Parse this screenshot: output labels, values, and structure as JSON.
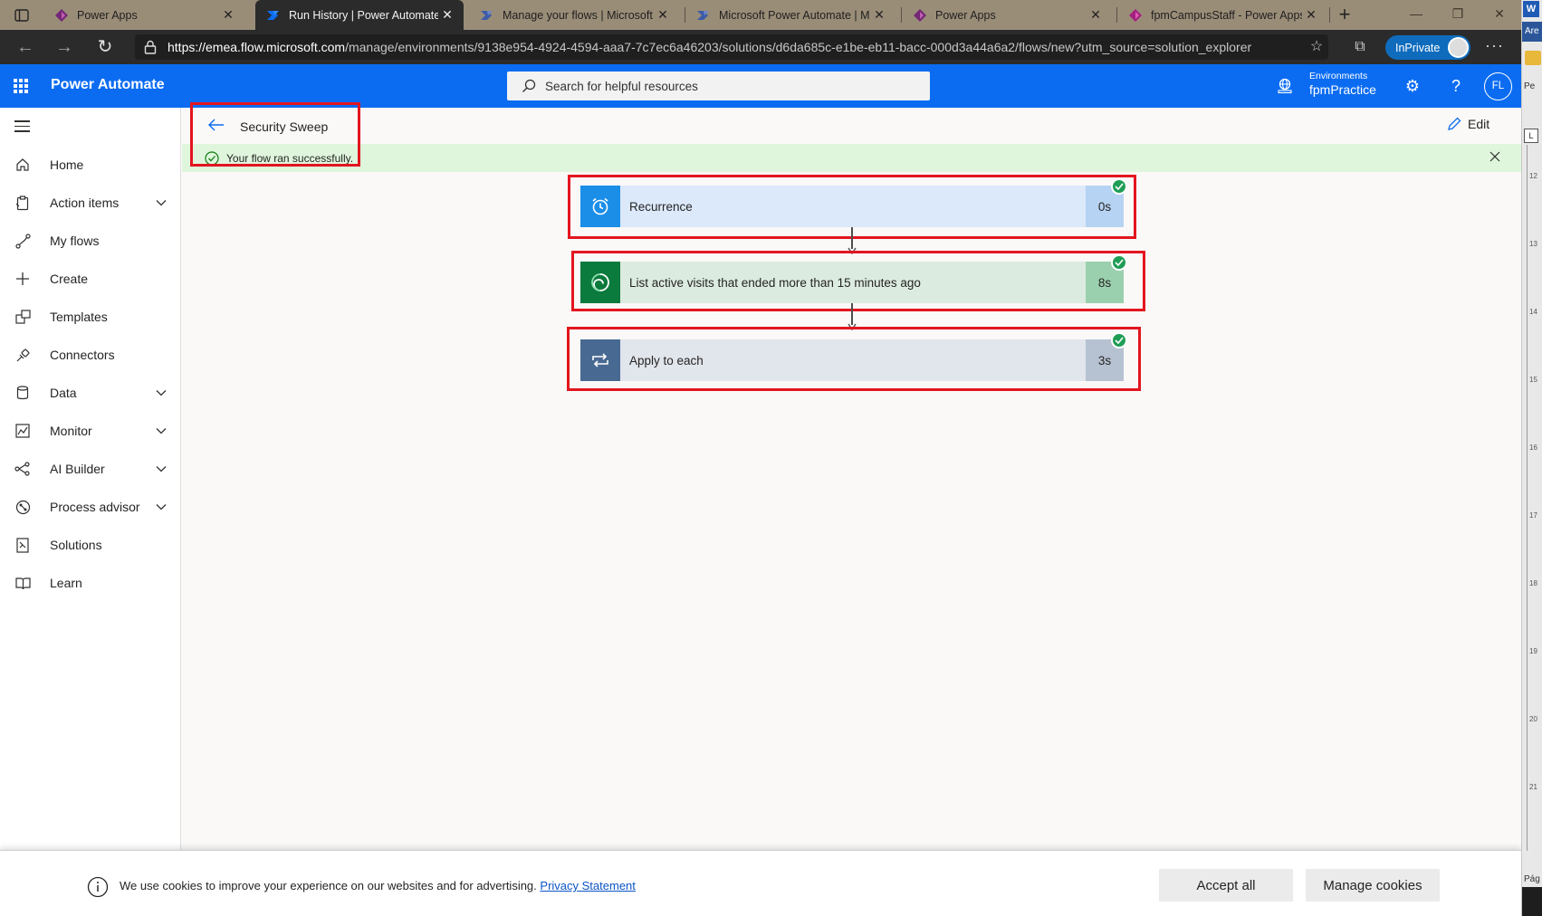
{
  "browser": {
    "tabs": [
      {
        "title": "Power Apps",
        "favicon": "power-apps-icon",
        "active": false
      },
      {
        "title": "Run History | Power Automate",
        "favicon": "power-automate-icon",
        "active": true
      },
      {
        "title": "Manage your flows | Microsoft F",
        "favicon": "power-automate-icon",
        "active": false
      },
      {
        "title": "Microsoft Power Automate | Mic",
        "favicon": "power-automate-icon",
        "active": false
      },
      {
        "title": "Power Apps",
        "favicon": "power-apps-icon",
        "active": false
      },
      {
        "title": "fpmCampusStaff - Power Apps",
        "favicon": "power-apps-icon",
        "active": false
      }
    ],
    "url_host": "https://emea.flow.microsoft.com",
    "url_path": "/manage/environments/9138e954-4924-4594-aaa7-7c7ec6a46203/solutions/d6da685c-e1be-eb11-bacc-000d3a44a6a2/flows/new?utm_source=solution_explorer",
    "inprivate_label": "InPrivate"
  },
  "header": {
    "app_title": "Power Automate",
    "search_placeholder": "Search for helpful resources",
    "env_label": "Environments",
    "env_name": "fpmPractice",
    "avatar_initials": "FL"
  },
  "nav": {
    "items": [
      {
        "label": "Home",
        "icon": "home-icon",
        "chevron": false
      },
      {
        "label": "Action items",
        "icon": "clipboard-icon",
        "chevron": true
      },
      {
        "label": "My flows",
        "icon": "flow-icon",
        "chevron": false
      },
      {
        "label": "Create",
        "icon": "plus-icon",
        "chevron": false
      },
      {
        "label": "Templates",
        "icon": "templates-icon",
        "chevron": false
      },
      {
        "label": "Connectors",
        "icon": "connector-icon",
        "chevron": false
      },
      {
        "label": "Data",
        "icon": "database-icon",
        "chevron": true
      },
      {
        "label": "Monitor",
        "icon": "monitor-icon",
        "chevron": true
      },
      {
        "label": "AI Builder",
        "icon": "ai-builder-icon",
        "chevron": true
      },
      {
        "label": "Process advisor",
        "icon": "process-advisor-icon",
        "chevron": true
      },
      {
        "label": "Solutions",
        "icon": "solutions-icon",
        "chevron": false
      },
      {
        "label": "Learn",
        "icon": "book-icon",
        "chevron": false
      }
    ]
  },
  "run": {
    "flow_name": "Security Sweep",
    "edit_label": "Edit",
    "status_message": "Your flow ran successfully.",
    "steps": [
      {
        "title": "Recurrence",
        "duration": "0s",
        "status": "succeeded",
        "icon": "alarm-clock-icon",
        "color": "#1b8ee8",
        "bg": "#dce9fb",
        "dur_bg": "#b6d3f3"
      },
      {
        "title": "List active visits that ended more than 15 minutes ago",
        "duration": "8s",
        "status": "succeeded",
        "icon": "dataverse-icon",
        "color": "#0a7a3d",
        "bg": "#dcebe0",
        "dur_bg": "#9bd0ae"
      },
      {
        "title": "Apply to each",
        "duration": "3s",
        "status": "succeeded",
        "icon": "loop-icon",
        "color": "#486991",
        "bg": "#e1e5ec",
        "dur_bg": "#b6c2d2"
      }
    ]
  },
  "cookies": {
    "text": "We use cookies to improve your experience on our websites and for advertising.",
    "link": "Privacy Statement",
    "accept": "Accept all",
    "manage": "Manage cookies"
  },
  "right_pane": {
    "top_label": "Are",
    "mid_label": "Pe",
    "bottom_label": "Pág",
    "ruler_numbers": [
      "12",
      "13",
      "14",
      "15",
      "16",
      "17",
      "18",
      "19",
      "20",
      "21"
    ]
  },
  "colors": {
    "brand": "#0b6cf2",
    "success": "#1f9d55",
    "banner": "#dff6dd",
    "highlight": "#e3151f"
  }
}
